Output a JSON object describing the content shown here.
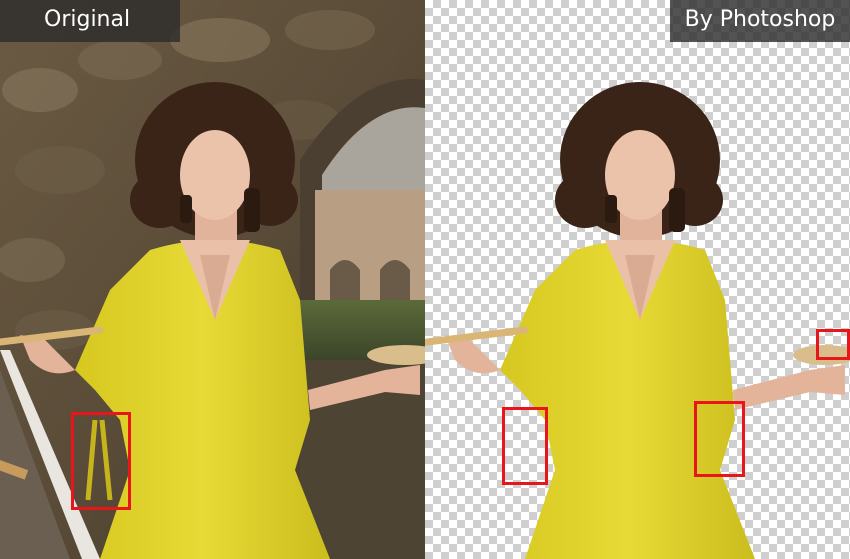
{
  "panels": {
    "left_label": "Original",
    "right_label": "By Photoshop"
  },
  "colors": {
    "dress": "#e2d52c",
    "highlight": "#e8161b",
    "label_bg": "#2d2d2d"
  }
}
